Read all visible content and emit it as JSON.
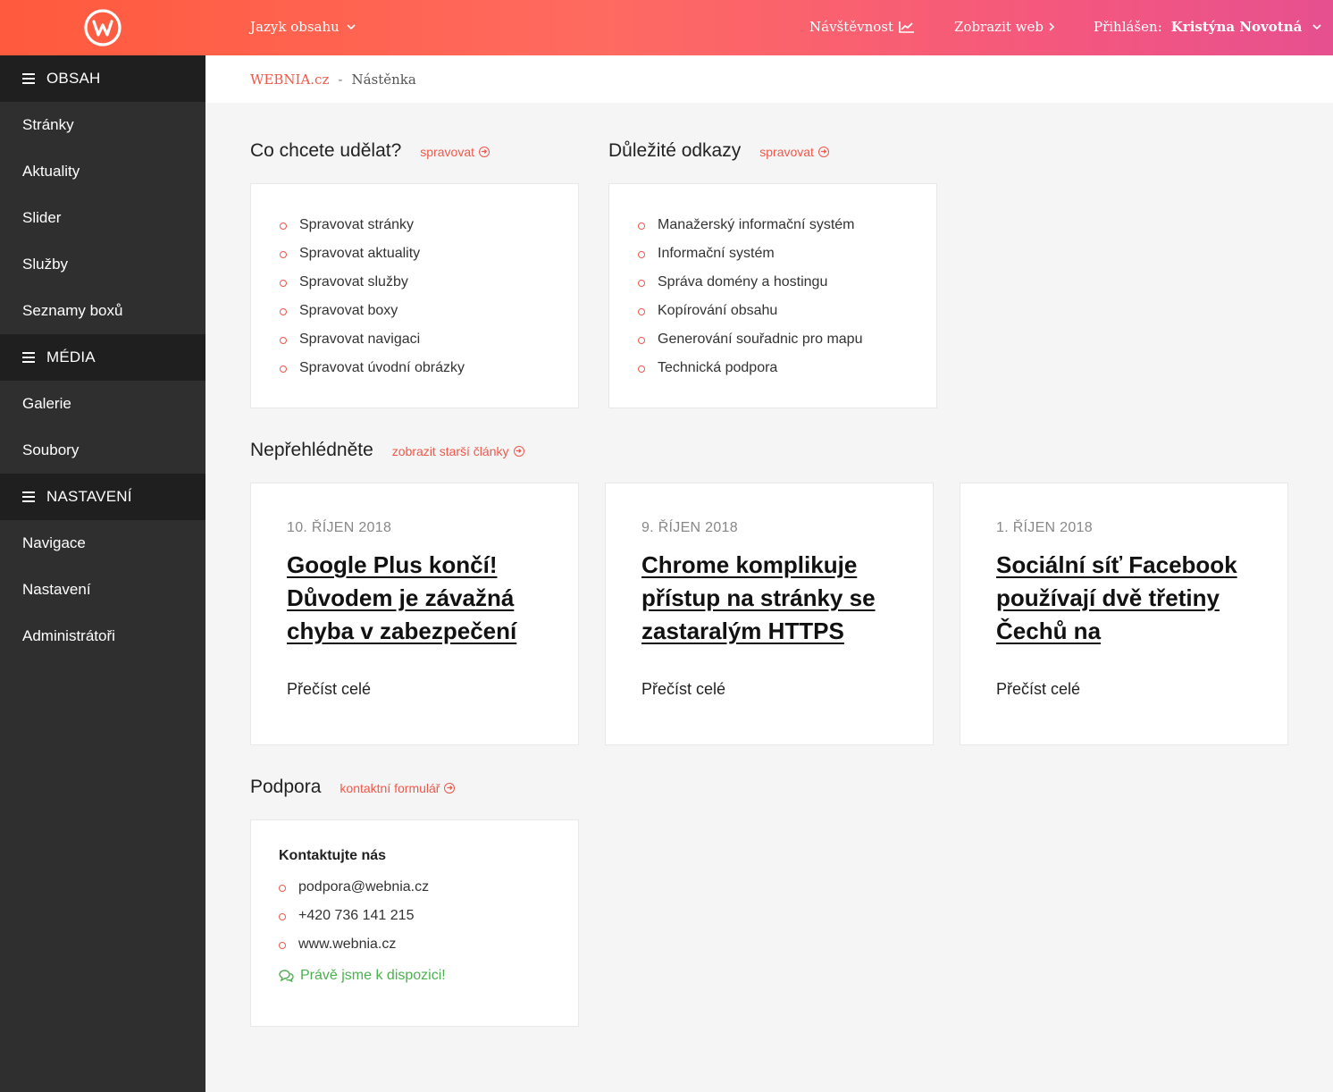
{
  "header": {
    "lang_label": "Jazyk obsahu",
    "visits_label": "Návštěvnost",
    "view_web_label": "Zobrazit web",
    "logged_prefix": "Přihlášen:",
    "user_name": "Kristýna Novotná"
  },
  "sidebar": {
    "sections": [
      {
        "title": "OBSAH",
        "items": [
          "Stránky",
          "Aktuality",
          "Slider",
          "Služby",
          "Seznamy boxů"
        ]
      },
      {
        "title": "MÉDIA",
        "items": [
          "Galerie",
          "Soubory"
        ]
      },
      {
        "title": "NASTAVENÍ",
        "items": [
          "Navigace",
          "Nastavení",
          "Administrátoři"
        ]
      }
    ]
  },
  "breadcrumb": {
    "site": "WEBNIA.cz",
    "separator": "-",
    "current": "Nástěnka"
  },
  "actions": {
    "title": "Co chcete udělat?",
    "link": "spravovat",
    "items": [
      "Spravovat stránky",
      "Spravovat aktuality",
      "Spravovat služby",
      "Spravovat boxy",
      "Spravovat navigaci",
      "Spravovat úvodní obrázky"
    ]
  },
  "links": {
    "title": "Důležité odkazy",
    "link": "spravovat",
    "items": [
      "Manažerský informační systém",
      "Informační systém",
      "Správa domény a hostingu",
      "Kopírování obsahu",
      "Generování souřadnic pro mapu",
      "Technická podpora"
    ]
  },
  "news": {
    "title": "Nepřehlédněte",
    "link": "zobrazit starší články",
    "articles": [
      {
        "date": "10. ŘÍJEN 2018",
        "title": "Google Plus končí! Důvodem je závažná chyba v zabezpečení",
        "more": "Přečíst celé"
      },
      {
        "date": "9. ŘÍJEN 2018",
        "title": "Chrome komplikuje přístup na stránky se zastaralým HTTPS",
        "more": "Přečíst celé"
      },
      {
        "date": "1. ŘÍJEN 2018",
        "title": "Sociální síť Facebook používají dvě třetiny Čechů na",
        "more": "Přečíst celé"
      }
    ]
  },
  "support": {
    "title": "Podpora",
    "link": "kontaktní formulář",
    "card_title": "Kontaktujte nás",
    "contacts": [
      "podpora@webnia.cz",
      "+420 736 141 215",
      "www.webnia.cz"
    ],
    "availability": "Právě jsme k dispozici!"
  },
  "colors": {
    "accent": "#f0584a",
    "sidebar": "#2f2f2f",
    "sidebar_section": "#1f1f1f",
    "available": "#4caf50"
  }
}
